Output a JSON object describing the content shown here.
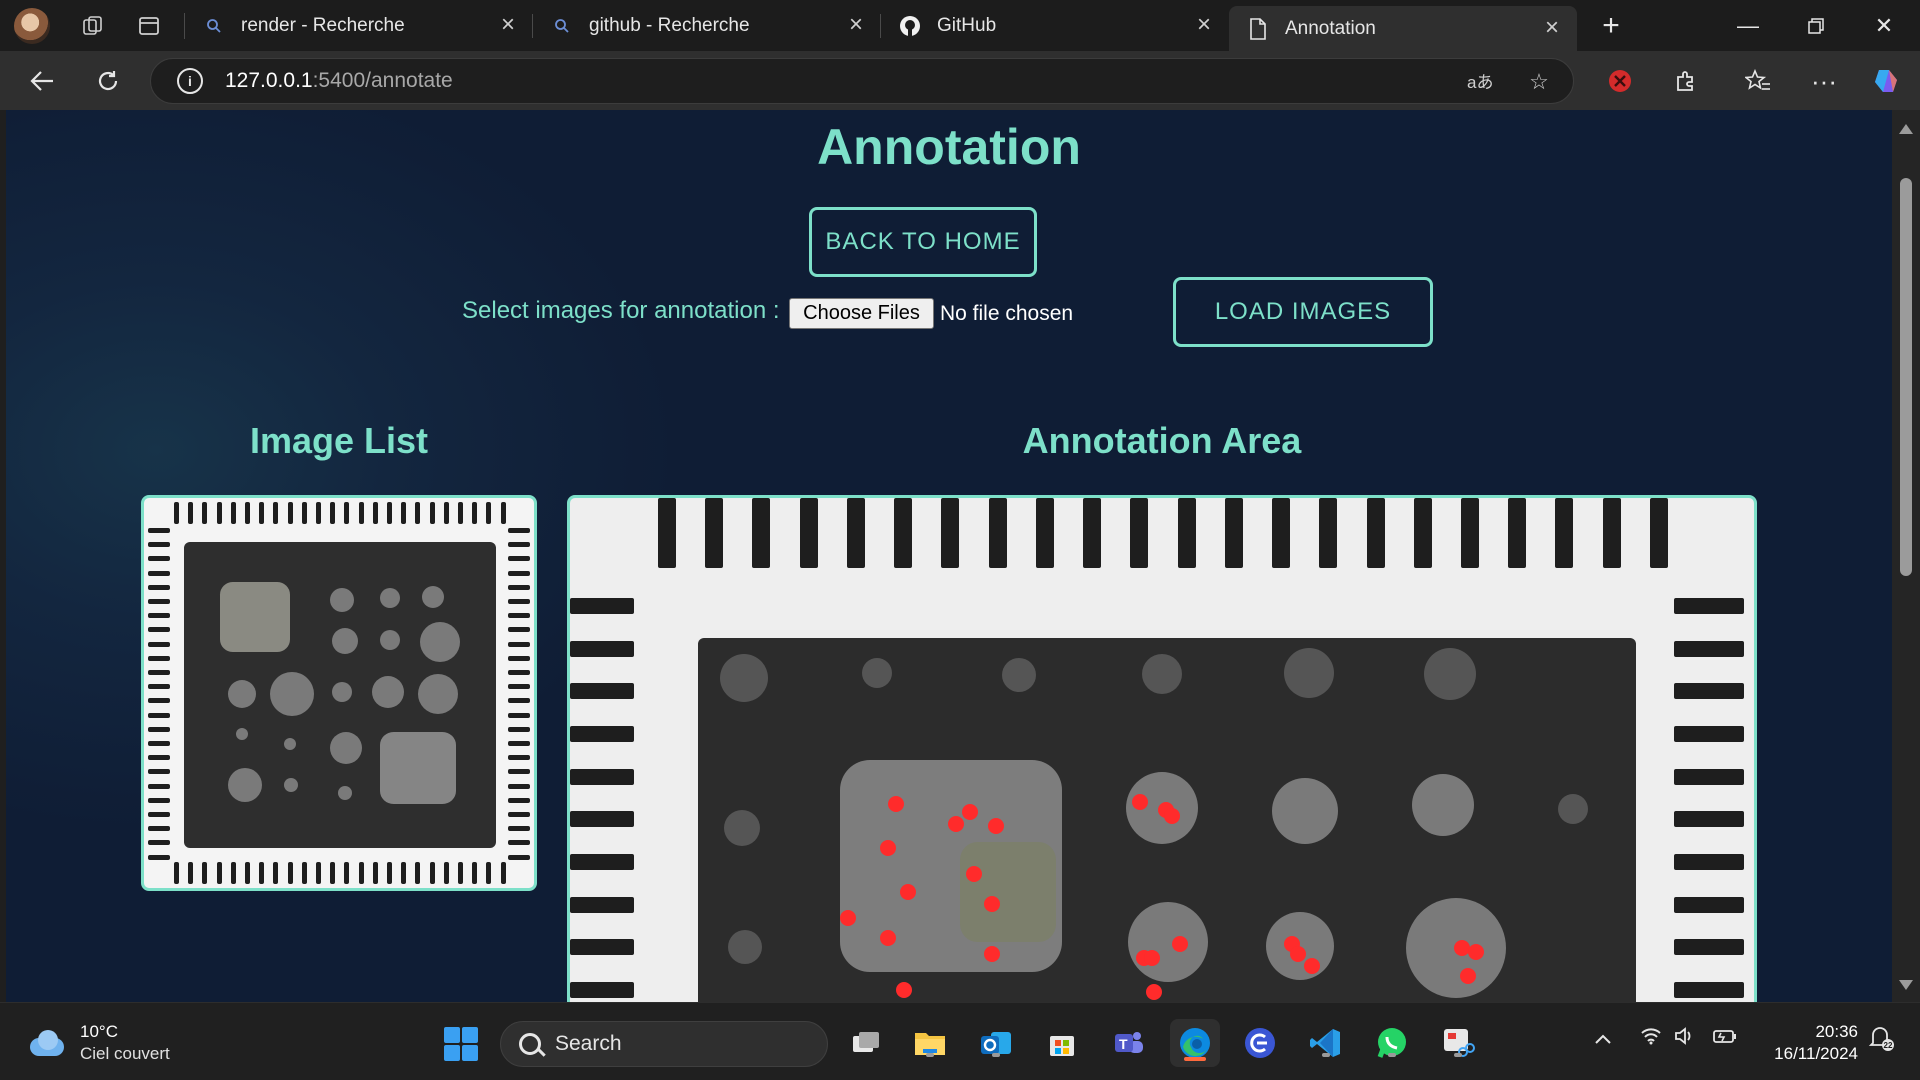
{
  "browser": {
    "tabs": [
      {
        "title": "render - Recherche",
        "icon": "search-icon"
      },
      {
        "title": "github - Recherche",
        "icon": "search-icon"
      },
      {
        "title": "GitHub",
        "icon": "github-icon"
      },
      {
        "title": "Annotation",
        "icon": "page-icon",
        "active": true
      }
    ],
    "url_host": "127.0.0.1",
    "url_path": ":5400/annotate"
  },
  "page": {
    "title": "Annotation",
    "back_button": "BACK TO HOME",
    "select_label": "Select images for annotation :",
    "choose_files": "Choose Files",
    "no_file": "No file chosen",
    "load_button": "LOAD IMAGES",
    "image_list_heading": "Image List",
    "annotation_area_heading": "Annotation Area",
    "annotation_marker_color": "#ff2b2b",
    "accent_color": "#7de0c9"
  },
  "taskbar": {
    "weather_temp": "10°C",
    "weather_cond": "Ciel couvert",
    "search_label": "Search",
    "time": "20:36",
    "date": "16/11/2024",
    "notification_count": "22"
  }
}
